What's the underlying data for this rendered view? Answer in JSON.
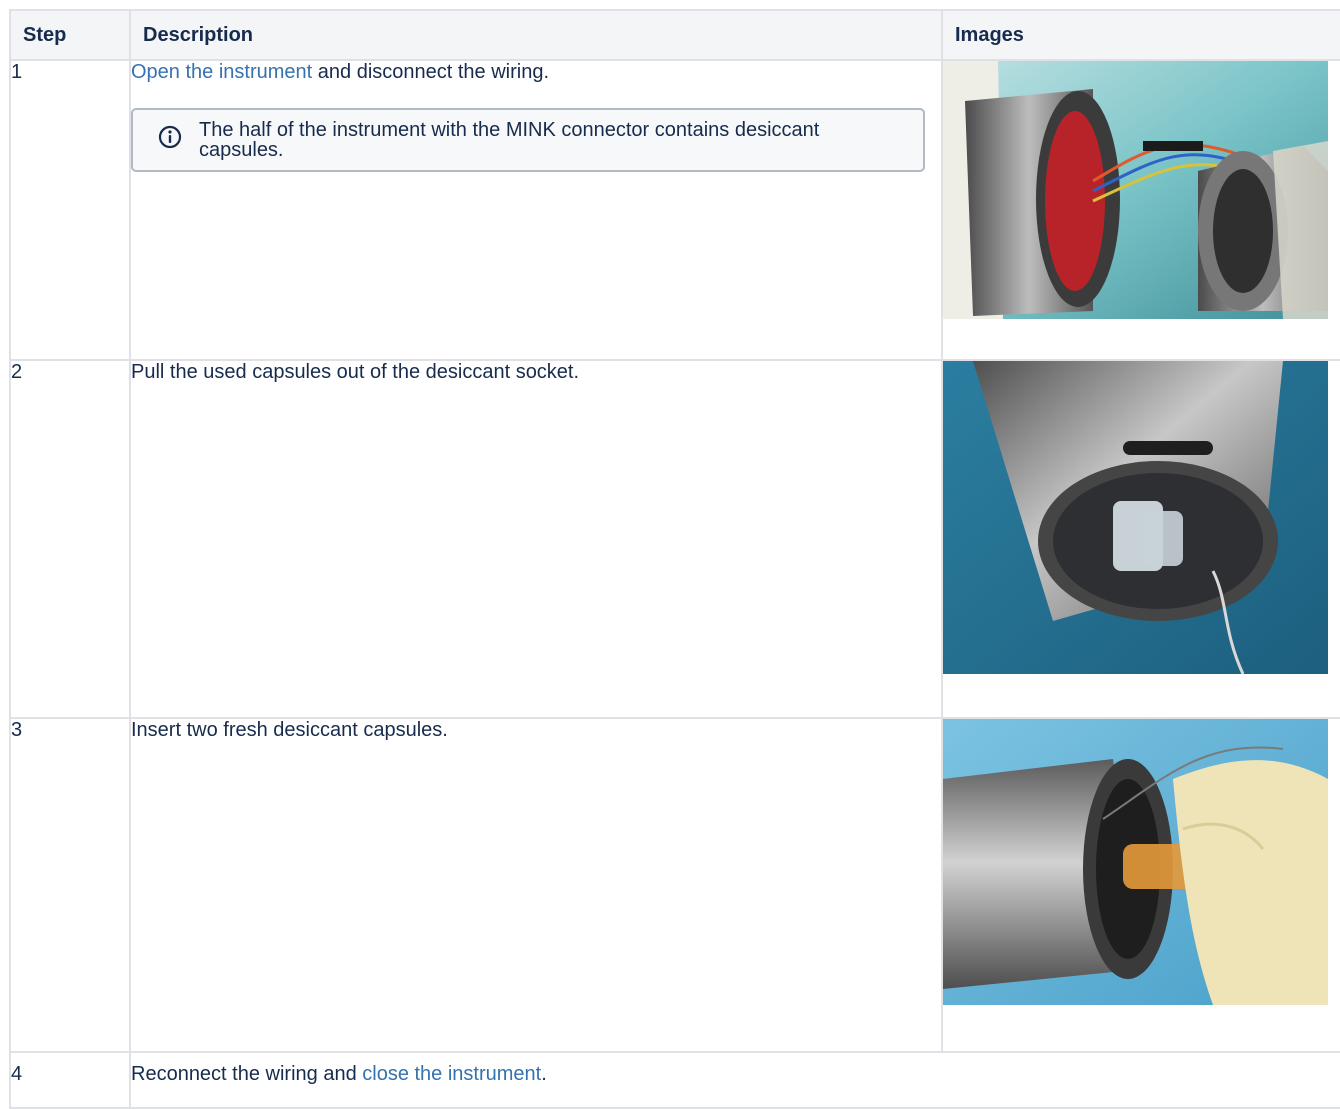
{
  "table": {
    "headers": [
      "Step",
      "Description",
      "Images"
    ],
    "rows": [
      {
        "step": "1",
        "link_text": "Open the instrument",
        "text_after": " and disconnect the wiring.",
        "info_note": "The half of the instrument with the  MINK connector contains desiccant capsules.",
        "image_icon": "opened-instrument-wiring-photo"
      },
      {
        "step": "2",
        "text": "Pull the used capsules out of the desiccant socket.",
        "image_icon": "desiccant-socket-photo"
      },
      {
        "step": "3",
        "text": "Insert two fresh desiccant capsules.",
        "image_icon": "inserting-capsules-photo"
      },
      {
        "step": "4",
        "text_before": "Reconnect the wiring and ",
        "link_text": "close the instrument",
        "text_after": "."
      }
    ]
  },
  "colors": {
    "link": "#3572b0",
    "border": "#dfe1e6",
    "header_bg": "#f4f5f7",
    "info_border": "#b3bac5",
    "text": "#172b4d"
  }
}
